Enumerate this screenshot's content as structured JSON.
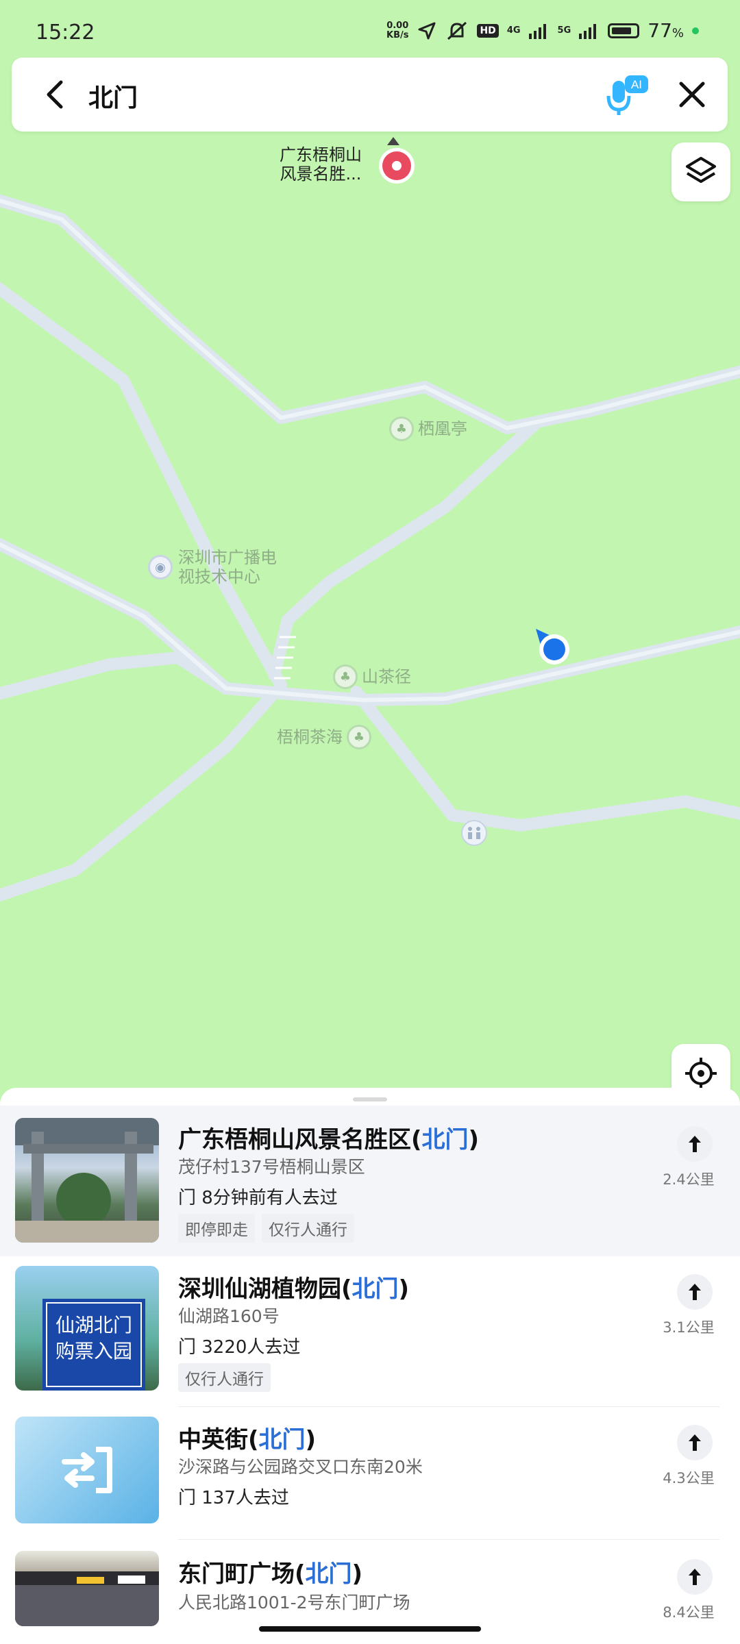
{
  "status_bar": {
    "time": "15:22",
    "net_speed_value": "0.00",
    "net_speed_unit": "KB/s",
    "hd_badge": "HD",
    "net1": "4G",
    "net2": "5G",
    "battery_pct": "77",
    "battery_suffix": "%"
  },
  "search": {
    "query": "北门",
    "ai_badge": "AI"
  },
  "map": {
    "pois": {
      "scenic_area": "广东梧桐山\n风景名胜...",
      "qi_huang_ting": "栖凰亭",
      "broadcast_center": "深圳市广播电\n视技术中心",
      "shan_cha_jing": "山茶径",
      "wu_tong_cha_hai": "梧桐茶海"
    }
  },
  "results": [
    {
      "title_main": "广东梧桐山风景名胜区(",
      "title_kw": "北门",
      "title_end": ")",
      "address": "茂仔村137号梧桐山景区",
      "visit": "门  8分钟前有人去过",
      "tags": [
        "即停即走",
        "仅行人通行"
      ],
      "distance": "2.4公里"
    },
    {
      "title_main": "深圳仙湖植物园(",
      "title_kw": "北门",
      "title_end": ")",
      "address": "仙湖路160号",
      "visit": "门  3220人去过",
      "tags": [
        "仅行人通行"
      ],
      "distance": "3.1公里",
      "thumb_text": "仙湖北门\n购票入园"
    },
    {
      "title_main": "中英街(",
      "title_kw": "北门",
      "title_end": ")",
      "address": "沙深路与公园路交叉口东南20米",
      "visit": "门  137人去过",
      "tags": [],
      "distance": "4.3公里"
    },
    {
      "title_main": "东门町广场(",
      "title_kw": "北门",
      "title_end": ")",
      "address": "人民北路1001-2号东门町广场",
      "visit": "",
      "tags": [],
      "distance": "8.4公里"
    }
  ],
  "colors": {
    "map_bg": "#c2f5b0",
    "road": "#dde6ef",
    "accent": "#2b6fd6",
    "marker_red": "#e84a5f",
    "location_blue": "#1a73e8"
  }
}
